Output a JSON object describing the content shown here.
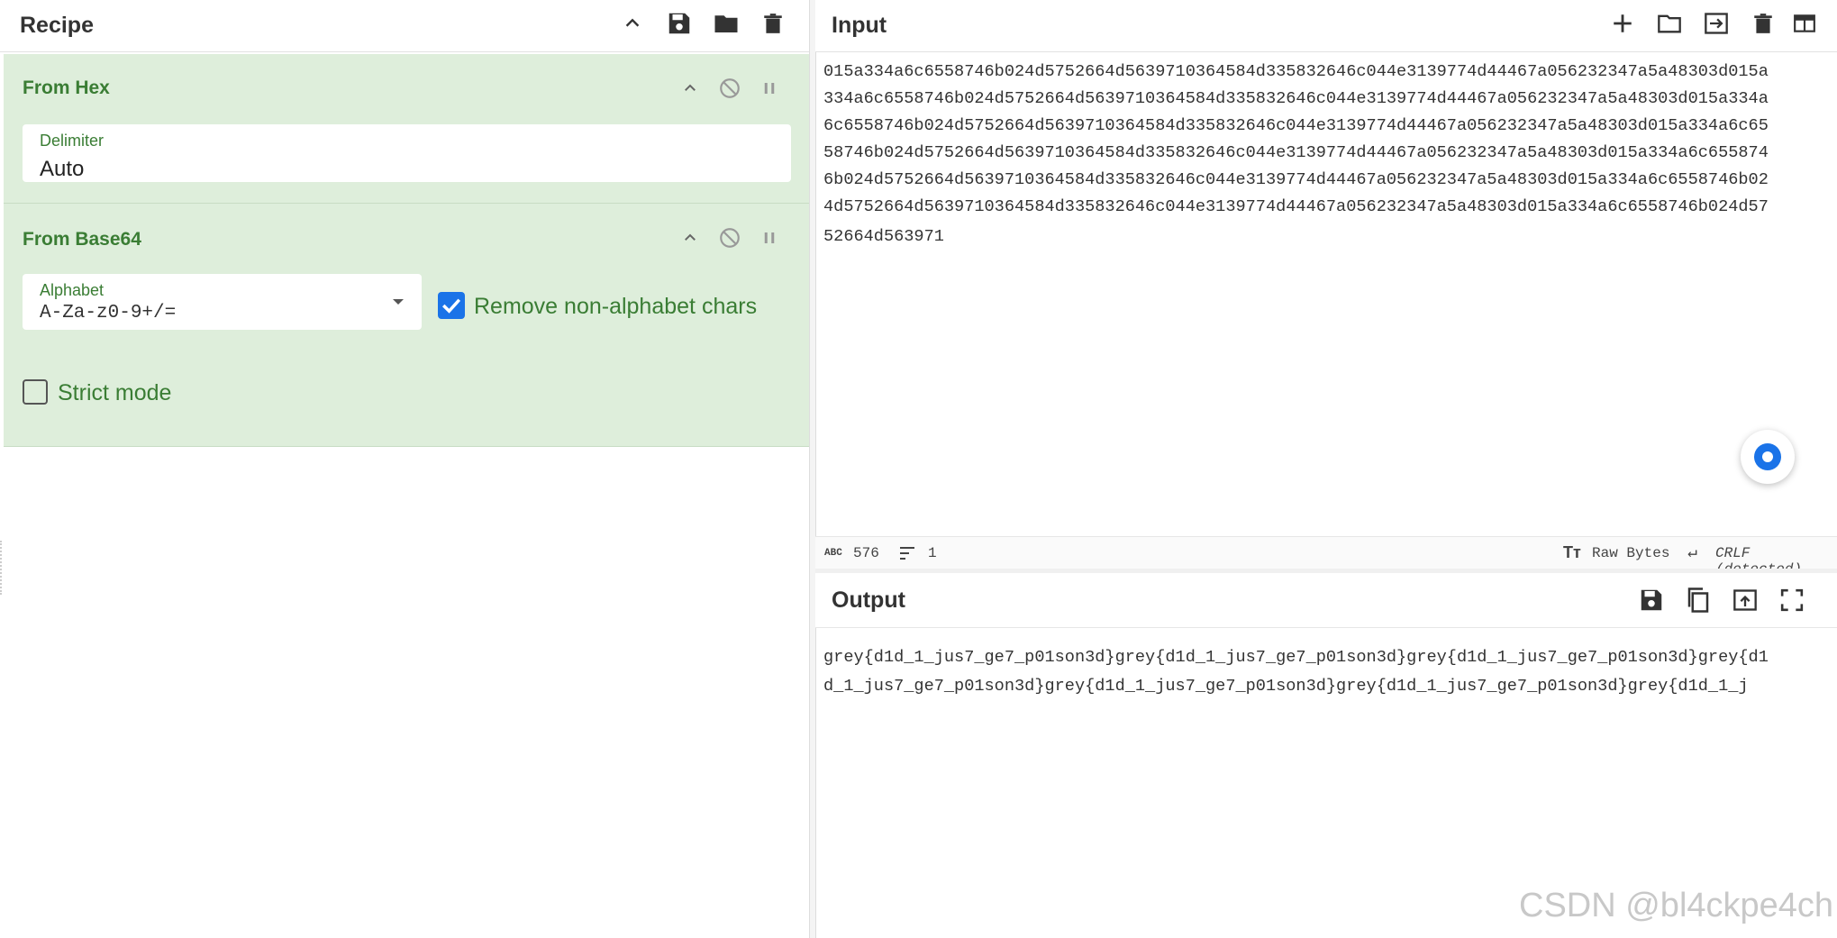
{
  "recipe": {
    "title": "Recipe",
    "header_icons": [
      "chevron-up-icon",
      "save-icon",
      "folder-icon",
      "trash-icon"
    ]
  },
  "ops": [
    {
      "title": "From Hex",
      "delimiter_label": "Delimiter",
      "delimiter_value": "Auto"
    },
    {
      "title": "From Base64",
      "alphabet_label": "Alphabet",
      "alphabet_value": "A-Za-z0-9+/=",
      "remove_label": "Remove non-alphabet chars",
      "remove_checked": true,
      "strict_label": "Strict mode",
      "strict_checked": false
    }
  ],
  "input": {
    "title": "Input",
    "lines": [
      "015a334a6c6558746b024d5752664d5639710364584d335832646c044e3139774d44467a056232347a5a48303d015a",
      "334a6c6558746b024d5752664d5639710364584d335832646c044e3139774d44467a056232347a5a48303d015a334a",
      "6c6558746b024d5752664d5639710364584d335832646c044e3139774d44467a056232347a5a48303d015a334a6c65",
      "58746b024d5752664d5639710364584d335832646c044e3139774d44467a056232347a5a48303d015a334a6c655874",
      "6b024d5752664d5639710364584d335832646c044e3139774d44467a056232347a5a48303d015a334a6c6558746b02",
      "4d5752664d5639710364584d335832646c044e3139774d44467a056232347a5a48303d015a334a6c6558746b024d57",
      "52664d563971"
    ],
    "status": {
      "length": "576",
      "lines": "1",
      "encoding": "Raw Bytes",
      "eol": "CRLF (detected)"
    }
  },
  "output": {
    "title": "Output",
    "lines": [
      "grey{d1d_1_jus7_ge7_p01son3d}grey{d1d_1_jus7_ge7_p01son3d}grey{d1d_1_jus7_ge7_p01son3d}grey{d1",
      "d_1_jus7_ge7_p01son3d}grey{d1d_1_jus7_ge7_p01son3d}grey{d1d_1_jus7_ge7_p01son3d}grey{d1d_1_j"
    ]
  },
  "watermark": "CSDN @bl4ckpe4ch",
  "colors": {
    "accent_green": "#3a7d34",
    "op_bg": "#deeedb",
    "checkbox_blue": "#1a73e8"
  }
}
